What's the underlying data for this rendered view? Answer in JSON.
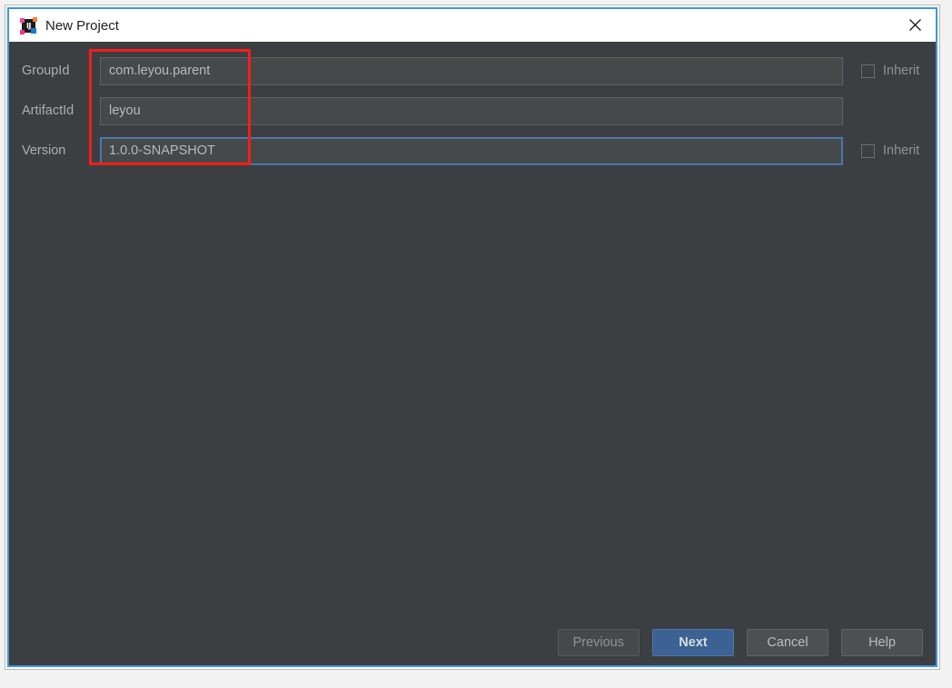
{
  "window": {
    "title": "New Project",
    "app_icon": "intellij-idea-icon",
    "close_icon": "close-icon",
    "icon_text": "IJ"
  },
  "form": {
    "rows": [
      {
        "label": "GroupId",
        "value": "com.leyou.parent",
        "field_name": "groupid",
        "focused": false,
        "has_inherit": true,
        "inherit_label": "Inherit",
        "inherit_checked": false
      },
      {
        "label": "ArtifactId",
        "value": "leyou",
        "field_name": "artifactid",
        "focused": false,
        "has_inherit": false,
        "inherit_label": "",
        "inherit_checked": false
      },
      {
        "label": "Version",
        "value": "1.0.0-SNAPSHOT",
        "field_name": "version",
        "focused": true,
        "has_inherit": true,
        "inherit_label": "Inherit",
        "inherit_checked": false
      }
    ]
  },
  "annotation": {
    "name": "red-highlight-rectangle",
    "color": "#fb1b1b"
  },
  "buttons": {
    "previous": "Previous",
    "next": "Next",
    "cancel": "Cancel",
    "help": "Help"
  },
  "colors": {
    "background": "#3c3f41",
    "input_fill": "#45494a",
    "focus_border": "#4a76b0",
    "primary_button": "#3c6193",
    "window_border": "#3b97e3",
    "annotation": "#fb1b1b"
  }
}
